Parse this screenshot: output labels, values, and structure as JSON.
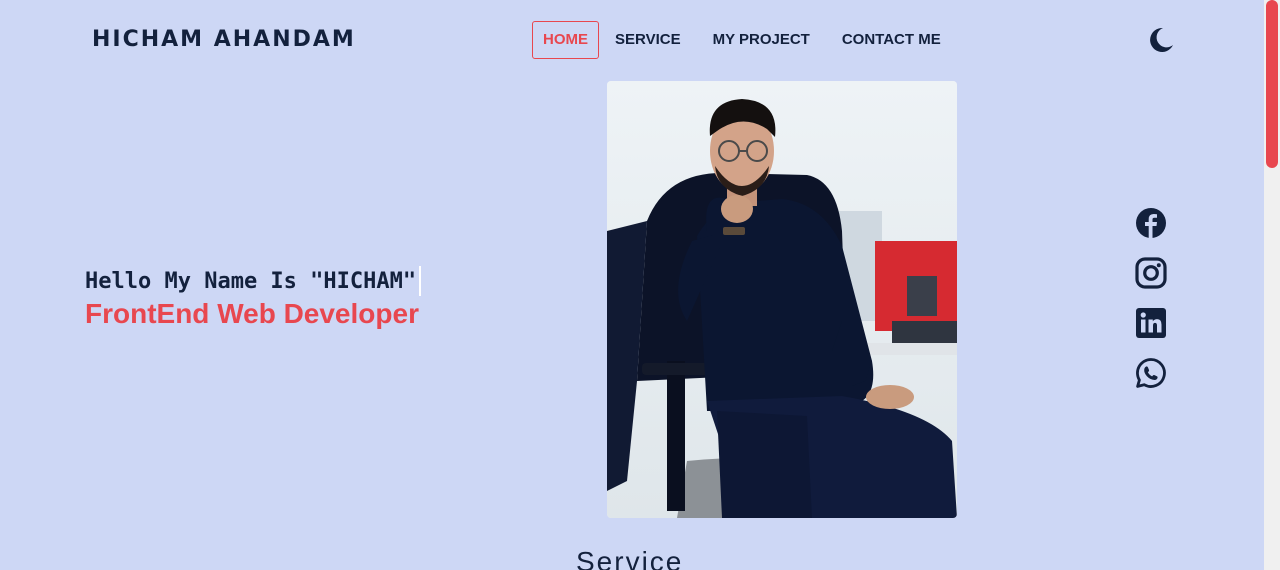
{
  "header": {
    "brand": "HICHAM AHANDAM",
    "nav": [
      {
        "label": "HOME",
        "active": true
      },
      {
        "label": "SERVICE",
        "active": false
      },
      {
        "label": "MY PROJECT",
        "active": false
      },
      {
        "label": "CONTACT ME",
        "active": false
      }
    ],
    "theme_icon": "moon-icon"
  },
  "hero": {
    "greeting": "Hello My Name Is \"HICHAM\"",
    "role": "FrontEnd Web Developer",
    "photo_icon": "portrait-photo"
  },
  "socials": [
    {
      "icon": "facebook-icon"
    },
    {
      "icon": "instagram-icon"
    },
    {
      "icon": "linkedin-icon"
    },
    {
      "icon": "whatsapp-icon"
    }
  ],
  "sections": {
    "service_title": "Service"
  },
  "colors": {
    "background": "#cdd7f5",
    "accent": "#e8474f",
    "text": "#13213d"
  }
}
